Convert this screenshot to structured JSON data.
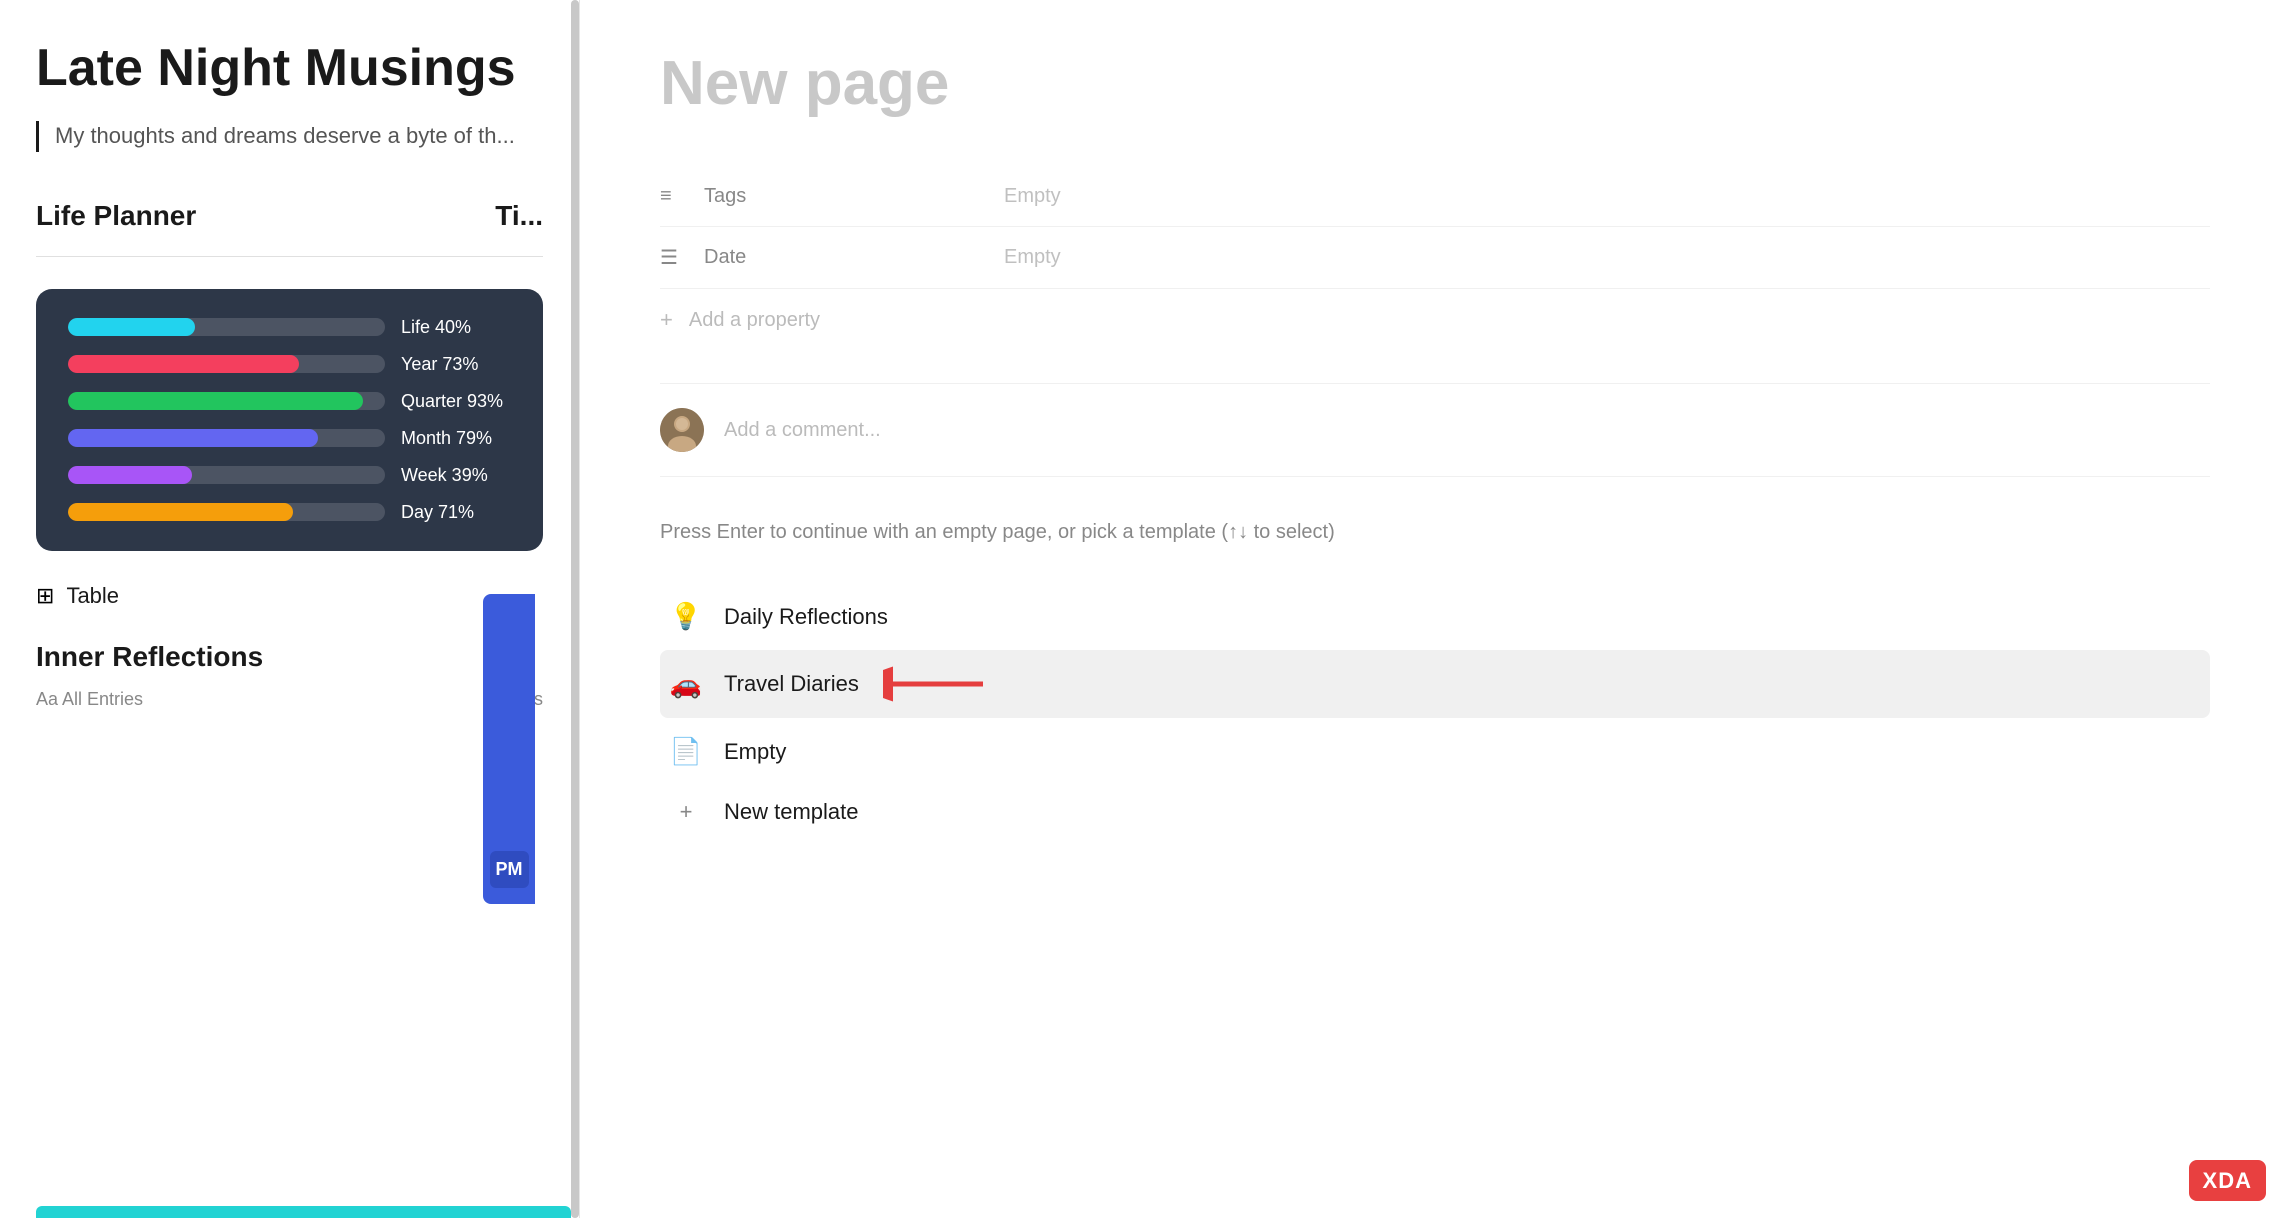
{
  "left": {
    "page_title": "Late Night Musings",
    "page_quote": "My thoughts and dreams deserve a byte of th...",
    "life_planner_label": "Life Planner",
    "timer_label": "Ti...",
    "progress_items": [
      {
        "label": "Life 40%",
        "percent": 40,
        "color": "#22d3ee"
      },
      {
        "label": "Year 73%",
        "percent": 73,
        "color": "#f43f5e"
      },
      {
        "label": "Quarter 93%",
        "percent": 93,
        "color": "#22c55e"
      },
      {
        "label": "Month 79%",
        "percent": 79,
        "color": "#6366f1"
      },
      {
        "label": "Week 39%",
        "percent": 39,
        "color": "#a855f7"
      },
      {
        "label": "Day 71%",
        "percent": 71,
        "color": "#f59e0b"
      }
    ],
    "pm_badge": "PM",
    "table_label": "Table",
    "inner_reflections_label": "Inner Reflections",
    "all_entries_label": "Aa All Entries",
    "tags_label": "≡ Tags"
  },
  "right": {
    "new_page_title": "New page",
    "properties": [
      {
        "icon": "≡",
        "name": "Tags",
        "value": "Empty"
      },
      {
        "icon": "☰",
        "name": "Date",
        "value": "Empty"
      }
    ],
    "add_property_label": "Add a property",
    "comment_placeholder": "Add a comment...",
    "hint_text": "Press Enter to continue with an empty page, or pick a template (↑↓ to select)",
    "templates": [
      {
        "icon": "💡",
        "label": "Daily Reflections",
        "highlighted": false
      },
      {
        "icon": "🚗",
        "label": "Travel Diaries",
        "highlighted": true
      },
      {
        "icon": "📄",
        "label": "Empty",
        "highlighted": false
      },
      {
        "icon": "+",
        "label": "New template",
        "highlighted": false,
        "is_plus": true
      }
    ]
  }
}
